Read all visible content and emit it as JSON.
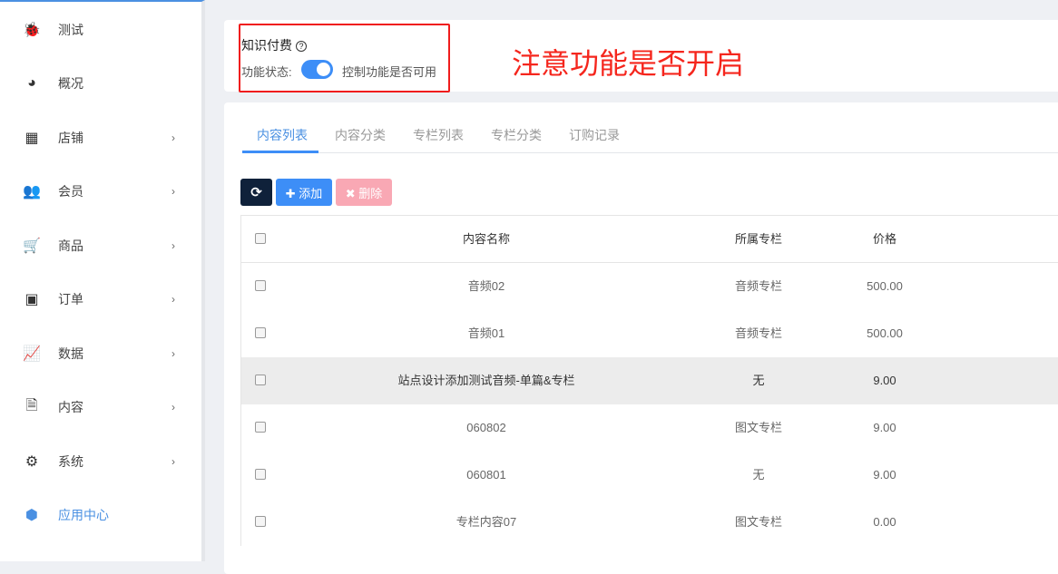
{
  "sidebar": {
    "items": [
      {
        "label": "测试",
        "icon": "bug-icon",
        "chevron": false
      },
      {
        "label": "概况",
        "icon": "dashboard-icon",
        "chevron": false
      },
      {
        "label": "店铺",
        "icon": "grid-icon",
        "chevron": true
      },
      {
        "label": "会员",
        "icon": "users-icon",
        "chevron": true
      },
      {
        "label": "商品",
        "icon": "cart-icon",
        "chevron": true
      },
      {
        "label": "订单",
        "icon": "money-icon",
        "chevron": true
      },
      {
        "label": "数据",
        "icon": "chart-icon",
        "chevron": true
      },
      {
        "label": "内容",
        "icon": "document-icon",
        "chevron": true
      },
      {
        "label": "系统",
        "icon": "gear-icon",
        "chevron": true
      },
      {
        "label": "应用中心",
        "icon": "cube-icon",
        "chevron": false,
        "active": true
      }
    ]
  },
  "feature": {
    "title": "知识付费",
    "status_label": "功能状态:",
    "enabled": true,
    "hint": "控制功能是否可用"
  },
  "annotation": "注意功能是否开启",
  "tabs": [
    "内容列表",
    "内容分类",
    "专栏列表",
    "专栏分类",
    "订购记录"
  ],
  "toolbar": {
    "add": "✚ 添加",
    "delete": "✖ 删除"
  },
  "table": {
    "headers": [
      "内容名称",
      "所属专栏",
      "价格"
    ],
    "rows": [
      [
        "音频02",
        "音频专栏",
        "500.00"
      ],
      [
        "音频01",
        "音频专栏",
        "500.00"
      ],
      [
        "站点设计添加测试音频-单篇&专栏",
        "无",
        "9.00"
      ],
      [
        "060802",
        "图文专栏",
        "9.00"
      ],
      [
        "060801",
        "无",
        "9.00"
      ],
      [
        "专栏内容07",
        "图文专栏",
        "0.00"
      ]
    ]
  }
}
